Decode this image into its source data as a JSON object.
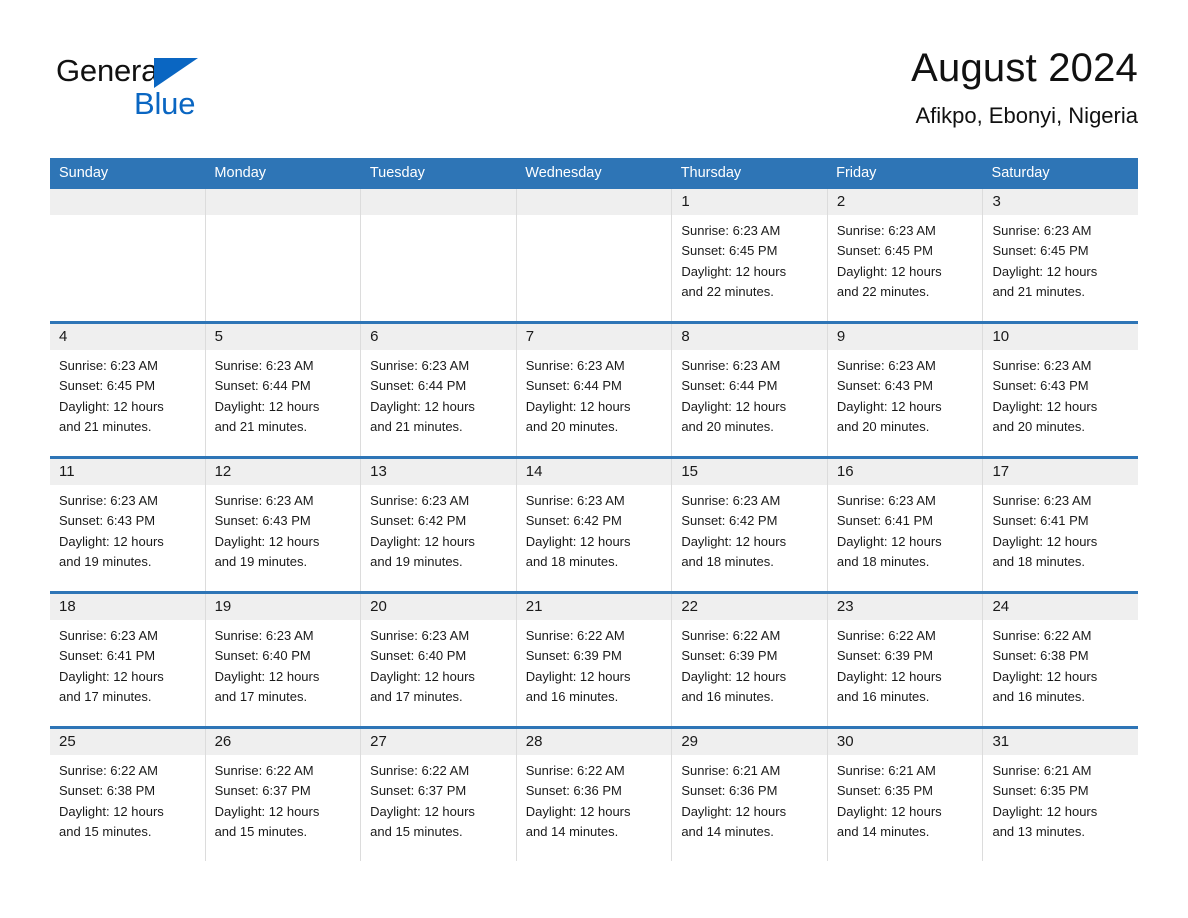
{
  "brand": {
    "name_part1": "General",
    "name_part2": "Blue",
    "triangle_color": "#0A66C2",
    "text_color": "#111111"
  },
  "header": {
    "month_title": "August 2024",
    "location": "Afikpo, Ebonyi, Nigeria"
  },
  "theme": {
    "header_blue": "#2E75B6",
    "day_band_gray": "#EFEFEF",
    "cell_border": "#dcdcdc",
    "text": "#1a1a1a"
  },
  "weekdays": [
    {
      "label": "Sunday"
    },
    {
      "label": "Monday"
    },
    {
      "label": "Tuesday"
    },
    {
      "label": "Wednesday"
    },
    {
      "label": "Thursday"
    },
    {
      "label": "Friday"
    },
    {
      "label": "Saturday"
    }
  ],
  "weeks": [
    {
      "days": [
        {
          "num": "",
          "empty": true,
          "sunrise": "",
          "sunset": "",
          "daylight_1": "",
          "daylight_2": ""
        },
        {
          "num": "",
          "empty": true,
          "sunrise": "",
          "sunset": "",
          "daylight_1": "",
          "daylight_2": ""
        },
        {
          "num": "",
          "empty": true,
          "sunrise": "",
          "sunset": "",
          "daylight_1": "",
          "daylight_2": ""
        },
        {
          "num": "",
          "empty": true,
          "sunrise": "",
          "sunset": "",
          "daylight_1": "",
          "daylight_2": ""
        },
        {
          "num": "1",
          "empty": false,
          "sunrise": "Sunrise: 6:23 AM",
          "sunset": "Sunset: 6:45 PM",
          "daylight_1": "Daylight: 12 hours",
          "daylight_2": "and 22 minutes."
        },
        {
          "num": "2",
          "empty": false,
          "sunrise": "Sunrise: 6:23 AM",
          "sunset": "Sunset: 6:45 PM",
          "daylight_1": "Daylight: 12 hours",
          "daylight_2": "and 22 minutes."
        },
        {
          "num": "3",
          "empty": false,
          "sunrise": "Sunrise: 6:23 AM",
          "sunset": "Sunset: 6:45 PM",
          "daylight_1": "Daylight: 12 hours",
          "daylight_2": "and 21 minutes."
        }
      ]
    },
    {
      "days": [
        {
          "num": "4",
          "empty": false,
          "sunrise": "Sunrise: 6:23 AM",
          "sunset": "Sunset: 6:45 PM",
          "daylight_1": "Daylight: 12 hours",
          "daylight_2": "and 21 minutes."
        },
        {
          "num": "5",
          "empty": false,
          "sunrise": "Sunrise: 6:23 AM",
          "sunset": "Sunset: 6:44 PM",
          "daylight_1": "Daylight: 12 hours",
          "daylight_2": "and 21 minutes."
        },
        {
          "num": "6",
          "empty": false,
          "sunrise": "Sunrise: 6:23 AM",
          "sunset": "Sunset: 6:44 PM",
          "daylight_1": "Daylight: 12 hours",
          "daylight_2": "and 21 minutes."
        },
        {
          "num": "7",
          "empty": false,
          "sunrise": "Sunrise: 6:23 AM",
          "sunset": "Sunset: 6:44 PM",
          "daylight_1": "Daylight: 12 hours",
          "daylight_2": "and 20 minutes."
        },
        {
          "num": "8",
          "empty": false,
          "sunrise": "Sunrise: 6:23 AM",
          "sunset": "Sunset: 6:44 PM",
          "daylight_1": "Daylight: 12 hours",
          "daylight_2": "and 20 minutes."
        },
        {
          "num": "9",
          "empty": false,
          "sunrise": "Sunrise: 6:23 AM",
          "sunset": "Sunset: 6:43 PM",
          "daylight_1": "Daylight: 12 hours",
          "daylight_2": "and 20 minutes."
        },
        {
          "num": "10",
          "empty": false,
          "sunrise": "Sunrise: 6:23 AM",
          "sunset": "Sunset: 6:43 PM",
          "daylight_1": "Daylight: 12 hours",
          "daylight_2": "and 20 minutes."
        }
      ]
    },
    {
      "days": [
        {
          "num": "11",
          "empty": false,
          "sunrise": "Sunrise: 6:23 AM",
          "sunset": "Sunset: 6:43 PM",
          "daylight_1": "Daylight: 12 hours",
          "daylight_2": "and 19 minutes."
        },
        {
          "num": "12",
          "empty": false,
          "sunrise": "Sunrise: 6:23 AM",
          "sunset": "Sunset: 6:43 PM",
          "daylight_1": "Daylight: 12 hours",
          "daylight_2": "and 19 minutes."
        },
        {
          "num": "13",
          "empty": false,
          "sunrise": "Sunrise: 6:23 AM",
          "sunset": "Sunset: 6:42 PM",
          "daylight_1": "Daylight: 12 hours",
          "daylight_2": "and 19 minutes."
        },
        {
          "num": "14",
          "empty": false,
          "sunrise": "Sunrise: 6:23 AM",
          "sunset": "Sunset: 6:42 PM",
          "daylight_1": "Daylight: 12 hours",
          "daylight_2": "and 18 minutes."
        },
        {
          "num": "15",
          "empty": false,
          "sunrise": "Sunrise: 6:23 AM",
          "sunset": "Sunset: 6:42 PM",
          "daylight_1": "Daylight: 12 hours",
          "daylight_2": "and 18 minutes."
        },
        {
          "num": "16",
          "empty": false,
          "sunrise": "Sunrise: 6:23 AM",
          "sunset": "Sunset: 6:41 PM",
          "daylight_1": "Daylight: 12 hours",
          "daylight_2": "and 18 minutes."
        },
        {
          "num": "17",
          "empty": false,
          "sunrise": "Sunrise: 6:23 AM",
          "sunset": "Sunset: 6:41 PM",
          "daylight_1": "Daylight: 12 hours",
          "daylight_2": "and 18 minutes."
        }
      ]
    },
    {
      "days": [
        {
          "num": "18",
          "empty": false,
          "sunrise": "Sunrise: 6:23 AM",
          "sunset": "Sunset: 6:41 PM",
          "daylight_1": "Daylight: 12 hours",
          "daylight_2": "and 17 minutes."
        },
        {
          "num": "19",
          "empty": false,
          "sunrise": "Sunrise: 6:23 AM",
          "sunset": "Sunset: 6:40 PM",
          "daylight_1": "Daylight: 12 hours",
          "daylight_2": "and 17 minutes."
        },
        {
          "num": "20",
          "empty": false,
          "sunrise": "Sunrise: 6:23 AM",
          "sunset": "Sunset: 6:40 PM",
          "daylight_1": "Daylight: 12 hours",
          "daylight_2": "and 17 minutes."
        },
        {
          "num": "21",
          "empty": false,
          "sunrise": "Sunrise: 6:22 AM",
          "sunset": "Sunset: 6:39 PM",
          "daylight_1": "Daylight: 12 hours",
          "daylight_2": "and 16 minutes."
        },
        {
          "num": "22",
          "empty": false,
          "sunrise": "Sunrise: 6:22 AM",
          "sunset": "Sunset: 6:39 PM",
          "daylight_1": "Daylight: 12 hours",
          "daylight_2": "and 16 minutes."
        },
        {
          "num": "23",
          "empty": false,
          "sunrise": "Sunrise: 6:22 AM",
          "sunset": "Sunset: 6:39 PM",
          "daylight_1": "Daylight: 12 hours",
          "daylight_2": "and 16 minutes."
        },
        {
          "num": "24",
          "empty": false,
          "sunrise": "Sunrise: 6:22 AM",
          "sunset": "Sunset: 6:38 PM",
          "daylight_1": "Daylight: 12 hours",
          "daylight_2": "and 16 minutes."
        }
      ]
    },
    {
      "days": [
        {
          "num": "25",
          "empty": false,
          "sunrise": "Sunrise: 6:22 AM",
          "sunset": "Sunset: 6:38 PM",
          "daylight_1": "Daylight: 12 hours",
          "daylight_2": "and 15 minutes."
        },
        {
          "num": "26",
          "empty": false,
          "sunrise": "Sunrise: 6:22 AM",
          "sunset": "Sunset: 6:37 PM",
          "daylight_1": "Daylight: 12 hours",
          "daylight_2": "and 15 minutes."
        },
        {
          "num": "27",
          "empty": false,
          "sunrise": "Sunrise: 6:22 AM",
          "sunset": "Sunset: 6:37 PM",
          "daylight_1": "Daylight: 12 hours",
          "daylight_2": "and 15 minutes."
        },
        {
          "num": "28",
          "empty": false,
          "sunrise": "Sunrise: 6:22 AM",
          "sunset": "Sunset: 6:36 PM",
          "daylight_1": "Daylight: 12 hours",
          "daylight_2": "and 14 minutes."
        },
        {
          "num": "29",
          "empty": false,
          "sunrise": "Sunrise: 6:21 AM",
          "sunset": "Sunset: 6:36 PM",
          "daylight_1": "Daylight: 12 hours",
          "daylight_2": "and 14 minutes."
        },
        {
          "num": "30",
          "empty": false,
          "sunrise": "Sunrise: 6:21 AM",
          "sunset": "Sunset: 6:35 PM",
          "daylight_1": "Daylight: 12 hours",
          "daylight_2": "and 14 minutes."
        },
        {
          "num": "31",
          "empty": false,
          "sunrise": "Sunrise: 6:21 AM",
          "sunset": "Sunset: 6:35 PM",
          "daylight_1": "Daylight: 12 hours",
          "daylight_2": "and 13 minutes."
        }
      ]
    }
  ]
}
